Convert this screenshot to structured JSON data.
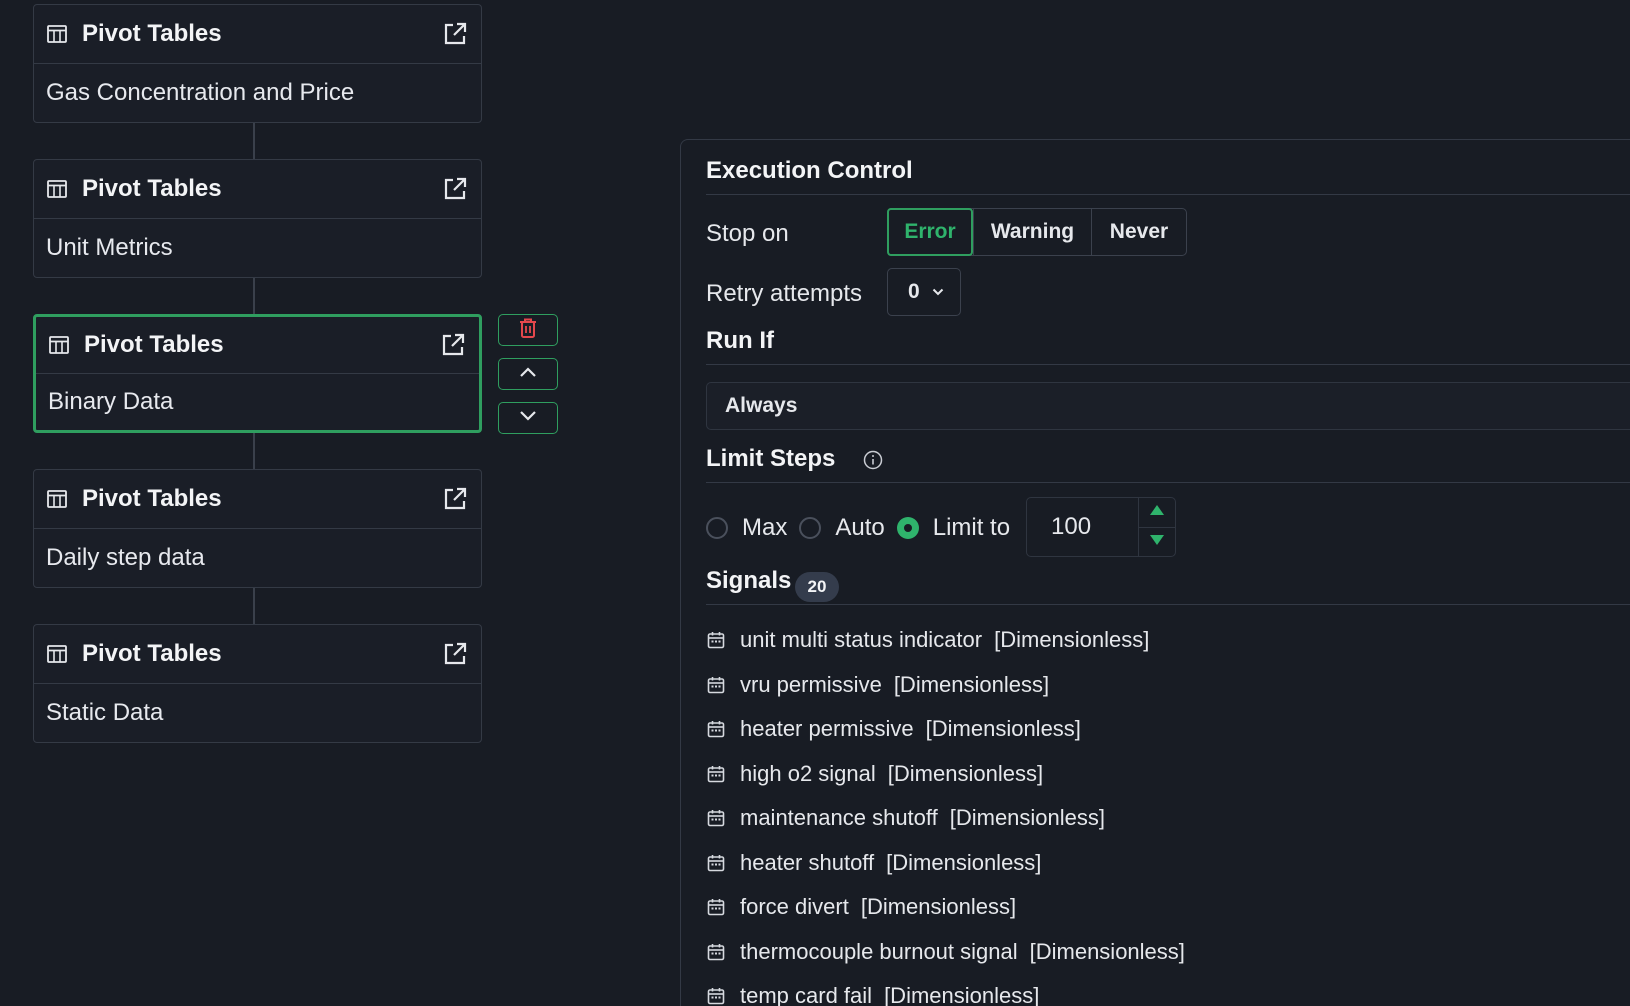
{
  "flow": {
    "nodes": [
      {
        "type_label": "Pivot Tables",
        "name": "Gas Concentration and Price",
        "selected": false
      },
      {
        "type_label": "Pivot Tables",
        "name": "Unit Metrics",
        "selected": false
      },
      {
        "type_label": "Pivot Tables",
        "name": "Binary Data",
        "selected": true
      },
      {
        "type_label": "Pivot Tables",
        "name": "Daily step data",
        "selected": false
      },
      {
        "type_label": "Pivot Tables",
        "name": "Static Data",
        "selected": false
      }
    ]
  },
  "panel": {
    "execution_control": {
      "title": "Execution Control",
      "stop_on_label": "Stop on",
      "stop_on_options": [
        "Error",
        "Warning",
        "Never"
      ],
      "stop_on_selected": "Error",
      "retry_label": "Retry attempts",
      "retry_value": "0"
    },
    "run_if": {
      "title": "Run If",
      "value": "Always"
    },
    "limit_steps": {
      "title": "Limit Steps",
      "options": [
        "Max",
        "Auto",
        "Limit to"
      ],
      "selected": "Limit to",
      "limit_value": "100"
    },
    "signals": {
      "title": "Signals",
      "count": "20",
      "items": [
        {
          "name": "unit multi status indicator",
          "unit": "[Dimensionless]"
        },
        {
          "name": "vru permissive",
          "unit": "[Dimensionless]"
        },
        {
          "name": "heater permissive",
          "unit": "[Dimensionless]"
        },
        {
          "name": "high o2 signal",
          "unit": "[Dimensionless]"
        },
        {
          "name": "maintenance shutoff",
          "unit": "[Dimensionless]"
        },
        {
          "name": "heater shutoff",
          "unit": "[Dimensionless]"
        },
        {
          "name": "force divert",
          "unit": "[Dimensionless]"
        },
        {
          "name": "thermocouple burnout signal",
          "unit": "[Dimensionless]"
        },
        {
          "name": "temp card fail",
          "unit": "[Dimensionless]"
        }
      ]
    }
  },
  "colors": {
    "background": "#181c24",
    "accent_green": "#2f9e5f",
    "danger_red": "#e5484d",
    "badge": "#343c4c"
  },
  "icons": {
    "node_type": "table-icon",
    "node_open": "external-link-icon",
    "delete": "trash-icon",
    "move_up": "chevron-up-icon",
    "move_down": "chevron-down-icon",
    "info": "info-icon",
    "signal": "calendar-icon"
  }
}
